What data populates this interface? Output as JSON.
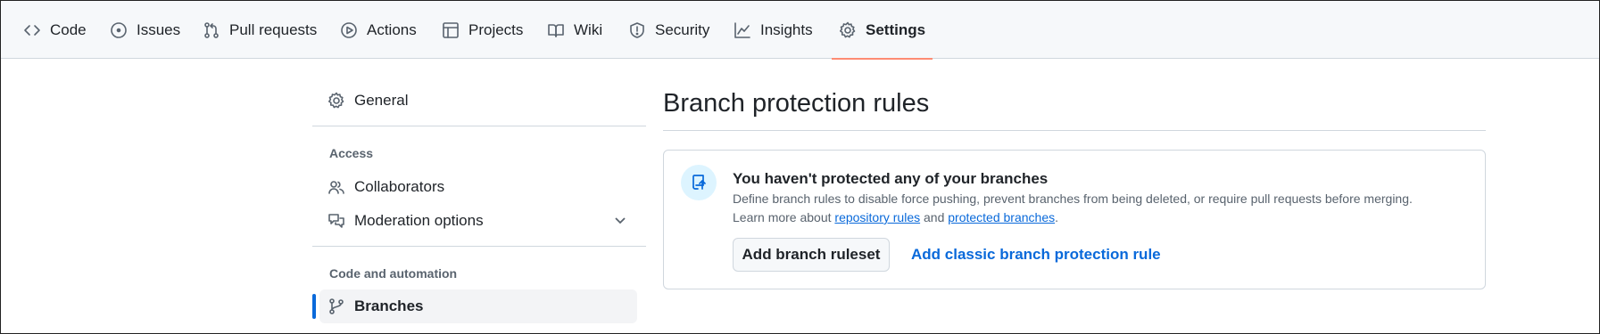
{
  "nav": {
    "tabs": [
      {
        "label": "Code",
        "icon": "code-icon"
      },
      {
        "label": "Issues",
        "icon": "issue-opened-icon"
      },
      {
        "label": "Pull requests",
        "icon": "git-pull-request-icon"
      },
      {
        "label": "Actions",
        "icon": "play-icon"
      },
      {
        "label": "Projects",
        "icon": "table-icon"
      },
      {
        "label": "Wiki",
        "icon": "book-icon"
      },
      {
        "label": "Security",
        "icon": "shield-icon"
      },
      {
        "label": "Insights",
        "icon": "graph-icon"
      },
      {
        "label": "Settings",
        "icon": "gear-icon",
        "active": true
      }
    ]
  },
  "sidebar": {
    "general": "General",
    "access_heading": "Access",
    "collaborators": "Collaborators",
    "moderation": "Moderation options",
    "code_heading": "Code and automation",
    "branches": "Branches"
  },
  "main": {
    "title": "Branch protection rules",
    "blank_title": "You haven't protected any of your branches",
    "blank_desc": "Define branch rules to disable force pushing, prevent branches from being deleted, or require pull requests before merging.",
    "learn_prefix": "Learn more about ",
    "link_rulesets": "repository rules",
    "learn_and": " and ",
    "link_protected": "protected branches",
    "learn_suffix": ".",
    "add_ruleset_button": "Add branch ruleset",
    "add_classic_link": "Add classic branch protection rule"
  },
  "colors": {
    "accent": "#0969da",
    "tab_underline": "#fd8c73",
    "nav_bg": "#f6f8fa"
  }
}
